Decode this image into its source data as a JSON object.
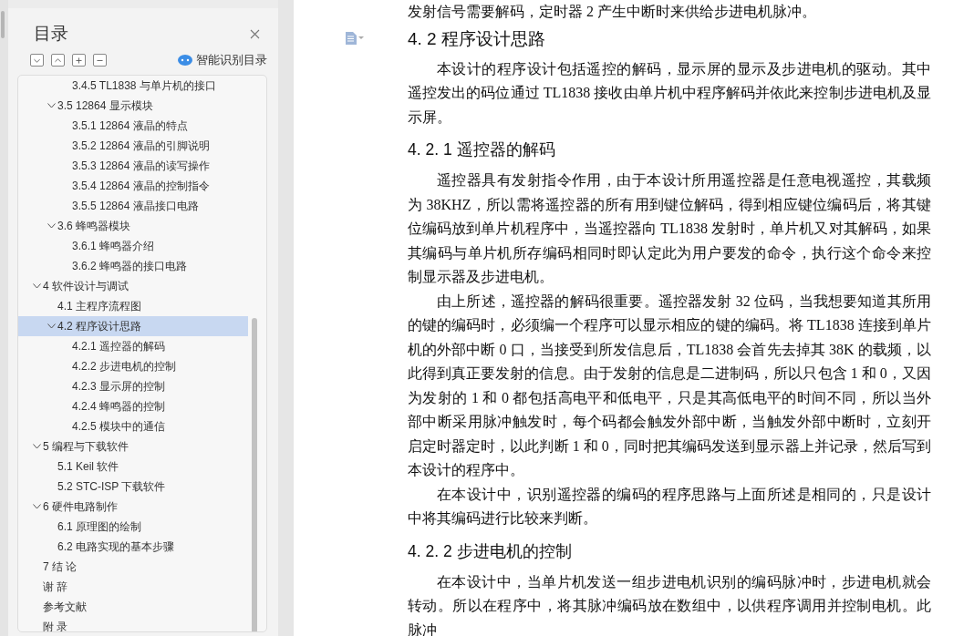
{
  "panel": {
    "title": "目录",
    "smart_button": "智能识别目录"
  },
  "toc": [
    {
      "children": [
        {
          "children": [
            {
              "label": "3.4.5 TL1838 与单片机的接口",
              "selected": false
            }
          ]
        },
        {
          "label": "3.5 12864 显示模块",
          "expanded": true,
          "selected": false,
          "children": [
            {
              "label": "3.5.1 12864 液晶的特点",
              "selected": false
            },
            {
              "label": "3.5.2 12864 液晶的引脚说明",
              "selected": false
            },
            {
              "label": "3.5.3 12864 液晶的读写操作",
              "selected": false
            },
            {
              "label": "3.5.4 12864 液晶的控制指令",
              "selected": false
            },
            {
              "label": "3.5.5 12864 液晶接口电路",
              "selected": false
            }
          ]
        },
        {
          "label": "3.6  蜂鸣器模块",
          "expanded": true,
          "selected": false,
          "children": [
            {
              "label": "3.6.1  蜂鸣器介绍",
              "selected": false
            },
            {
              "label": "3.6.2  蜂鸣器的接口电路",
              "selected": false
            }
          ]
        }
      ]
    },
    {
      "label": "4  软件设计与调试",
      "expanded": true,
      "selected": false,
      "children": [
        {
          "label": "4.1  主程序流程图",
          "selected": false
        },
        {
          "label": "4.2 程序设计思路",
          "expanded": true,
          "selected": true,
          "children": [
            {
              "label": "4.2.1  遥控器的解码",
              "selected": false
            },
            {
              "label": "4.2.2  步进电机的控制",
              "selected": false
            },
            {
              "label": "4.2.3  显示屏的控制",
              "selected": false
            },
            {
              "label": "4.2.4  蜂鸣器的控制",
              "selected": false
            },
            {
              "label": "4.2.5  模块中的通信",
              "selected": false
            }
          ]
        }
      ]
    },
    {
      "label": "5  编程与下载软件",
      "expanded": true,
      "selected": false,
      "children": [
        {
          "label": "5.1 Keil 软件",
          "selected": false
        },
        {
          "label": "5.2 STC-ISP 下载软件",
          "selected": false
        }
      ]
    },
    {
      "label": "6  硬件电路制作",
      "expanded": true,
      "selected": false,
      "children": [
        {
          "label": "6.1  原理图的绘制",
          "selected": false
        },
        {
          "label": "6.2  电路实现的基本步骤",
          "selected": false
        }
      ]
    },
    {
      "label": "7  结  论",
      "selected": false
    },
    {
      "label": "谢    辞",
      "selected": false
    },
    {
      "label": "参考文献",
      "selected": false
    },
    {
      "label": "附    录",
      "selected": false
    }
  ],
  "document": [
    {
      "kind": "paragraph",
      "text": "发射信号需要解码，定时器 2 产生中断时来供给步进电机脉冲。",
      "indent": false
    },
    {
      "kind": "heading",
      "text": "4. 2 程序设计思路"
    },
    {
      "kind": "paragraph",
      "text": "本设计的程序设计包括遥控的解码，显示屏的显示及步进电机的驱动。其中遥控发出的码位通过 TL1838 接收由单片机中程序解码并依此来控制步进电机及显示屏。",
      "indent": true
    },
    {
      "kind": "subheading",
      "text": "4. 2. 1  遥控器的解码"
    },
    {
      "kind": "paragraph",
      "text": "遥控器具有发射指令作用，由于本设计所用遥控器是任意电视遥控，其载频为 38KHZ，所以需将遥控器的所有用到键位解码，得到相应键位编码后，将其键位编码放到单片机程序中，当遥控器向 TL1838 发射时，单片机又对其解码，如果其编码与单片机所存编码相同时即认定此为用户要发的命令，执行这个命令来控制显示器及步进电机。",
      "indent": true
    },
    {
      "kind": "paragraph",
      "text": "由上所述，遥控器的解码很重要。遥控器发射 32 位码，当我想要知道其所用的键的编码时，必须编一个程序可以显示相应的键的编码。将 TL1838 连接到单片机的外部中断 0 口，当接受到所发信息后，TL1838 会首先去掉其 38K 的载频，以此得到真正要发射的信息。由于发射的信息是二进制码，所以只包含 1 和 0，又因为发射的 1 和 0 都包括高电平和低电平，只是其高低电平的时间不同，所以当外部中断采用脉冲触发时，每个码都会触发外部中断，当触发外部中断时，立刻开启定时器定时，以此判断 1 和 0，同时把其编码发送到显示器上并记录，然后写到本设计的程序中。",
      "indent": true
    },
    {
      "kind": "paragraph",
      "text": "在本设计中，识别遥控器的编码的程序思路与上面所述是相同的，只是设计中将其编码进行比较来判断。",
      "indent": true
    },
    {
      "kind": "subheading",
      "text": "4. 2. 2  步进电机的控制"
    },
    {
      "kind": "paragraph",
      "text": "在本设计中，当单片机发送一组步进电机识别的编码脉冲时，步进电机就会转动。所以在程序中，将其脉冲编码放在数组中，以供程序调用并控制电机。此脉冲",
      "indent": true
    }
  ]
}
